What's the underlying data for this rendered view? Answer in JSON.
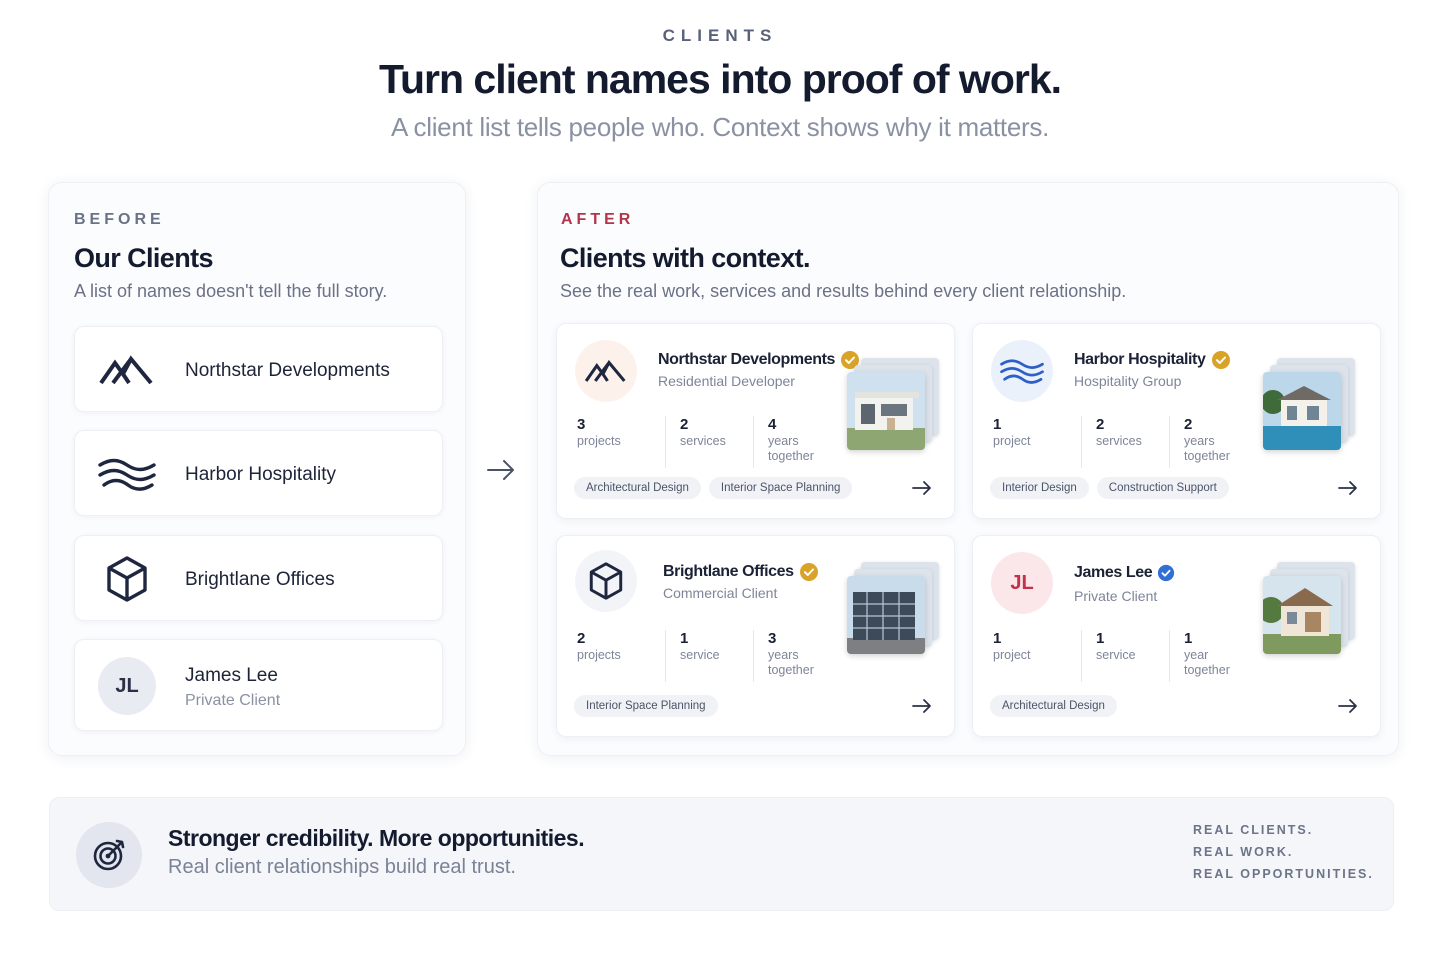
{
  "header": {
    "eyebrow": "CLIENTS",
    "headline": "Turn client names into proof of work.",
    "subline": "A client list tells people who. Context shows why it matters."
  },
  "before": {
    "eyebrow": "BEFORE",
    "title": "Our Clients",
    "description": "A list of names doesn't tell the full story.",
    "items": [
      {
        "name": "Northstar Developments",
        "icon": "mountain-logo-icon"
      },
      {
        "name": "Harbor Hospitality",
        "icon": "waves-logo-icon"
      },
      {
        "name": "Brightlane Offices",
        "icon": "cube-logo-icon"
      },
      {
        "name": "James Lee",
        "subtitle": "Private Client",
        "initials": "JL"
      }
    ]
  },
  "after": {
    "eyebrow": "AFTER",
    "title": "Clients with context.",
    "description": "See the real work, services and results behind every client relationship.",
    "cards": [
      {
        "name": "Northstar Developments",
        "type": "Residential Developer",
        "verified": "gold",
        "stats": [
          {
            "num": "3",
            "label": "projects"
          },
          {
            "num": "2",
            "label": "services"
          },
          {
            "num": "4",
            "label": "years together"
          }
        ],
        "tags": [
          "Architectural Design",
          "Interior Space Planning"
        ]
      },
      {
        "name": "Harbor Hospitality",
        "type": "Hospitality Group",
        "verified": "gold",
        "stats": [
          {
            "num": "1",
            "label": "project"
          },
          {
            "num": "2",
            "label": "services"
          },
          {
            "num": "2",
            "label": "years together"
          }
        ],
        "tags": [
          "Interior Design",
          "Construction Support"
        ]
      },
      {
        "name": "Brightlane Offices",
        "type": "Commercial Client",
        "verified": "gold",
        "stats": [
          {
            "num": "2",
            "label": "projects"
          },
          {
            "num": "1",
            "label": "service"
          },
          {
            "num": "3",
            "label": "years together"
          }
        ],
        "tags": [
          "Interior Space Planning"
        ]
      },
      {
        "name": "James Lee",
        "type": "Private Client",
        "initials": "JL",
        "verified": "blue",
        "stats": [
          {
            "num": "1",
            "label": "project"
          },
          {
            "num": "1",
            "label": "service"
          },
          {
            "num": "1",
            "label": "year together"
          }
        ],
        "tags": [
          "Architectural Design"
        ]
      }
    ]
  },
  "footer": {
    "title": "Stronger credibility. More opportunities.",
    "subtitle": "Real client relationships build real trust.",
    "taglines": [
      "REAL CLIENTS.",
      "REAL WORK.",
      "REAL OPPORTUNITIES."
    ]
  },
  "colors": {
    "accent_after": "#b3354c",
    "verified_gold": "#d9a228",
    "verified_blue": "#2f6fd6",
    "jl_pink": "#c2304a"
  }
}
